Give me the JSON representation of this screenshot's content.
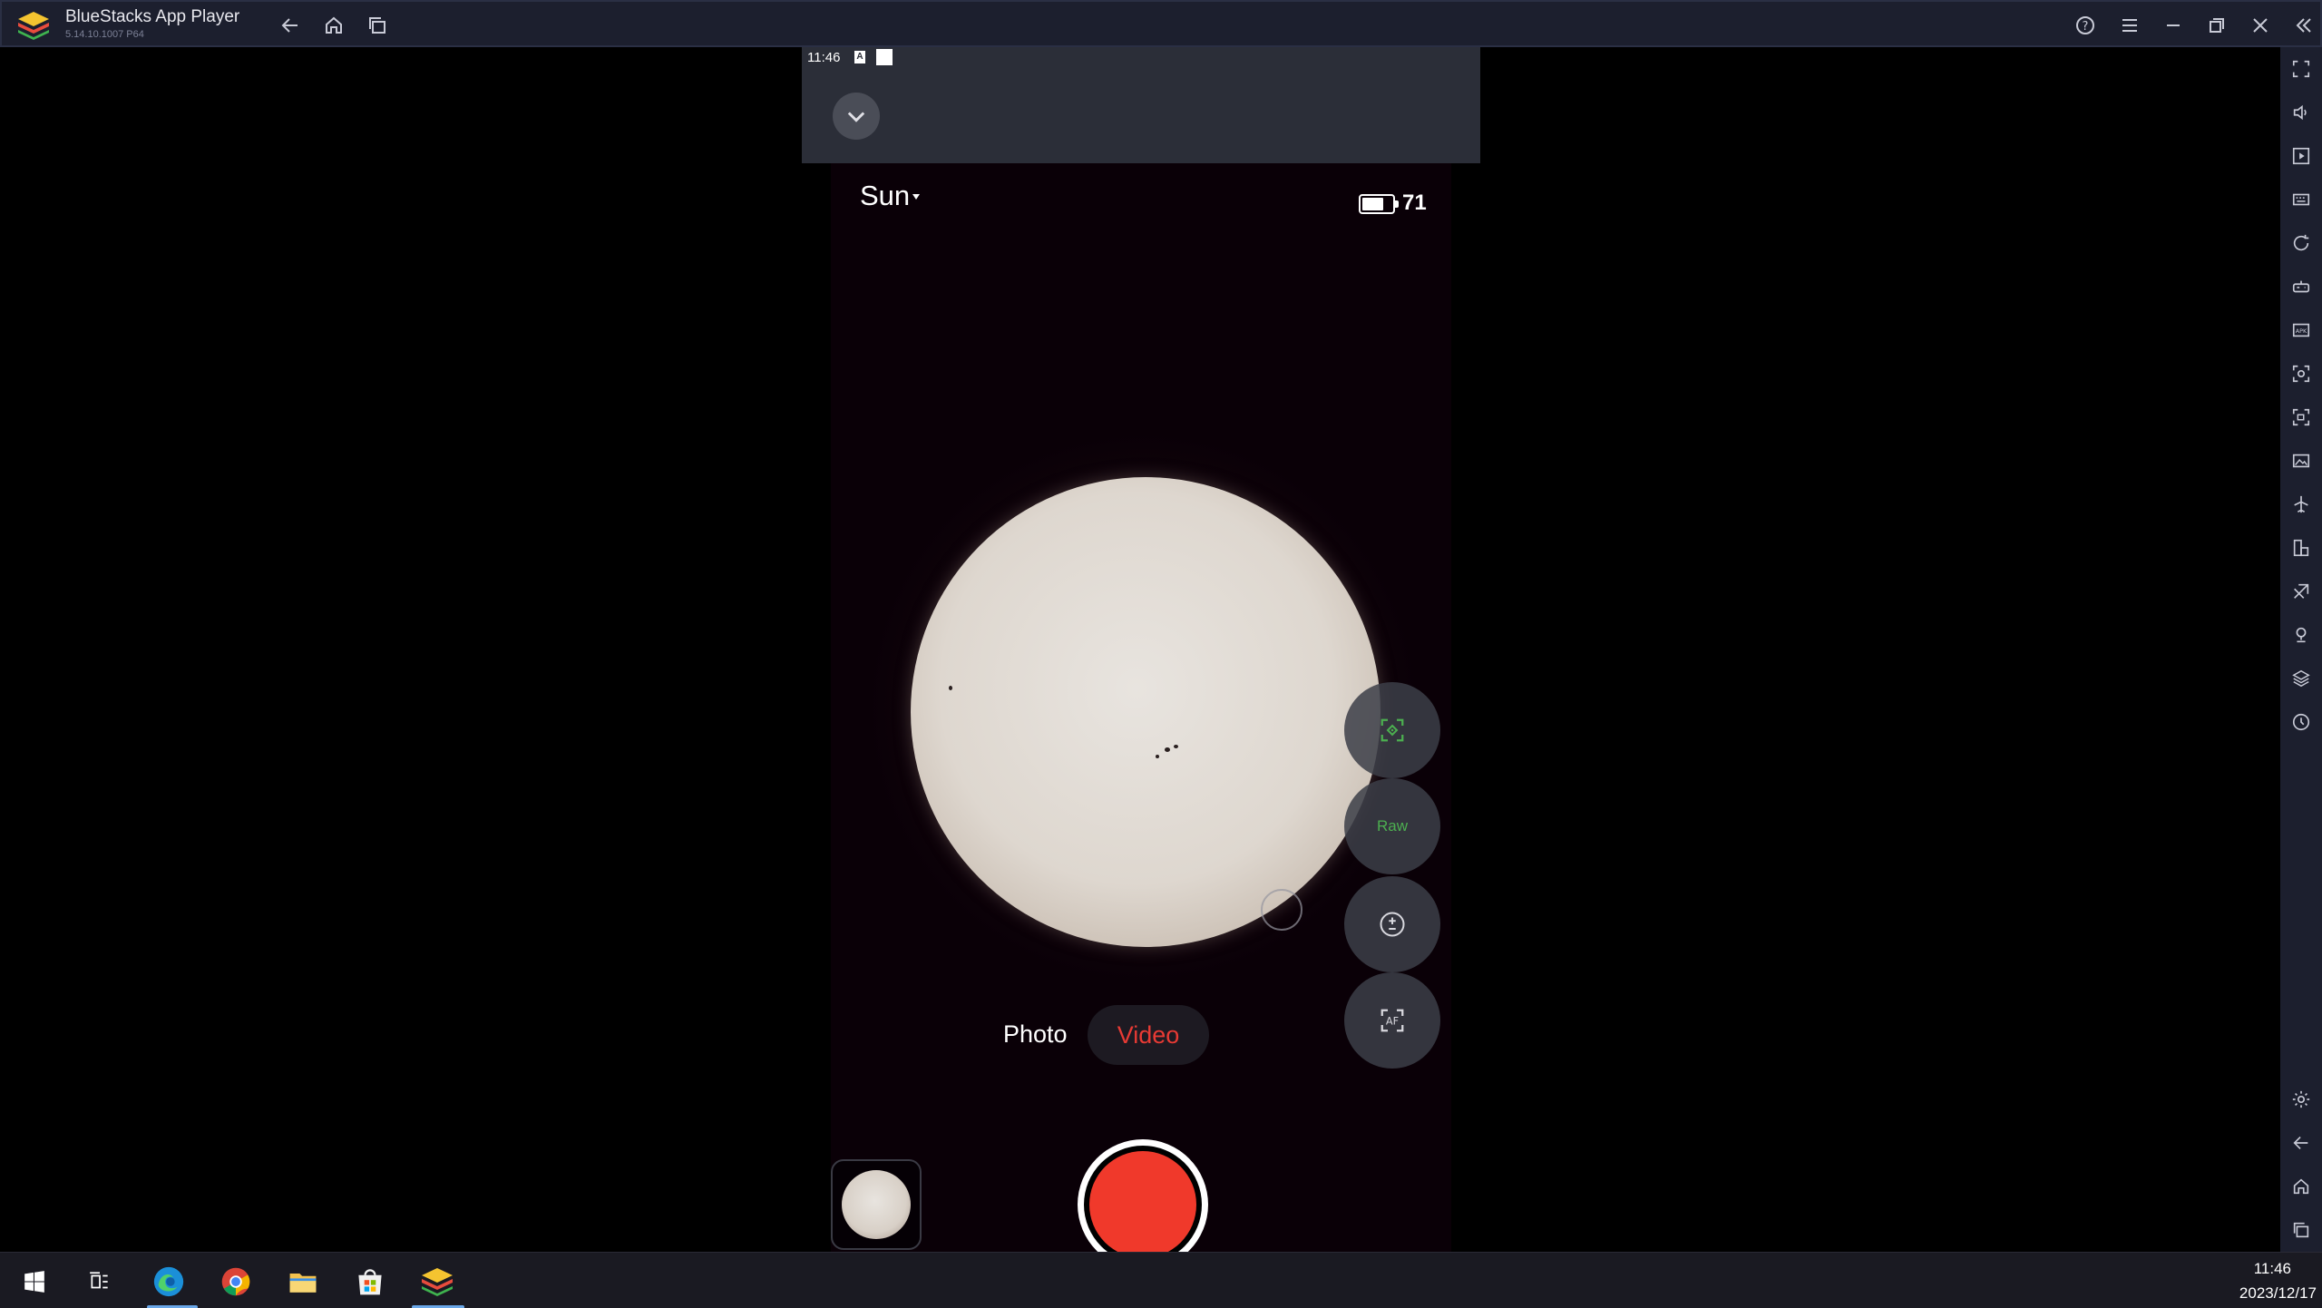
{
  "window": {
    "title": "BlueStacks App Player",
    "version": "5.14.10.1007 P64"
  },
  "android": {
    "status_time": "11:46",
    "status_badge": "A"
  },
  "camera": {
    "target": "Sun",
    "battery_level": "71",
    "battery_percent": 71,
    "raw_label": "Raw",
    "modes": {
      "photo": "Photo",
      "video": "Video"
    },
    "active_mode": "Video"
  },
  "taskbar": {
    "time": "11:46",
    "date": "2023/12/17"
  },
  "colors": {
    "record_red": "#f0392b",
    "active_mode_red": "#e83a34",
    "raw_green": "#4caf50",
    "titlebar_bg": "#1c1f2e"
  },
  "icons": {
    "titlebar": [
      "back-icon",
      "home-icon",
      "recent-apps-icon",
      "help-icon",
      "menu-icon",
      "minimize-icon",
      "restore-icon",
      "close-icon",
      "collapse-sidebar-icon"
    ],
    "sidebar": [
      "fullscreen-icon",
      "volume-icon",
      "media-icon",
      "keyboard-icon",
      "rotate-icon",
      "gamepad-icon",
      "apk-icon",
      "screenshot-icon",
      "record-screen-icon",
      "media-folder-icon",
      "airplane-icon",
      "multi-instance-icon",
      "eco-mode-icon",
      "location-icon",
      "layers-icon",
      "macro-icon",
      "settings-icon",
      "android-back-icon",
      "android-home-icon",
      "android-recents-icon"
    ]
  }
}
